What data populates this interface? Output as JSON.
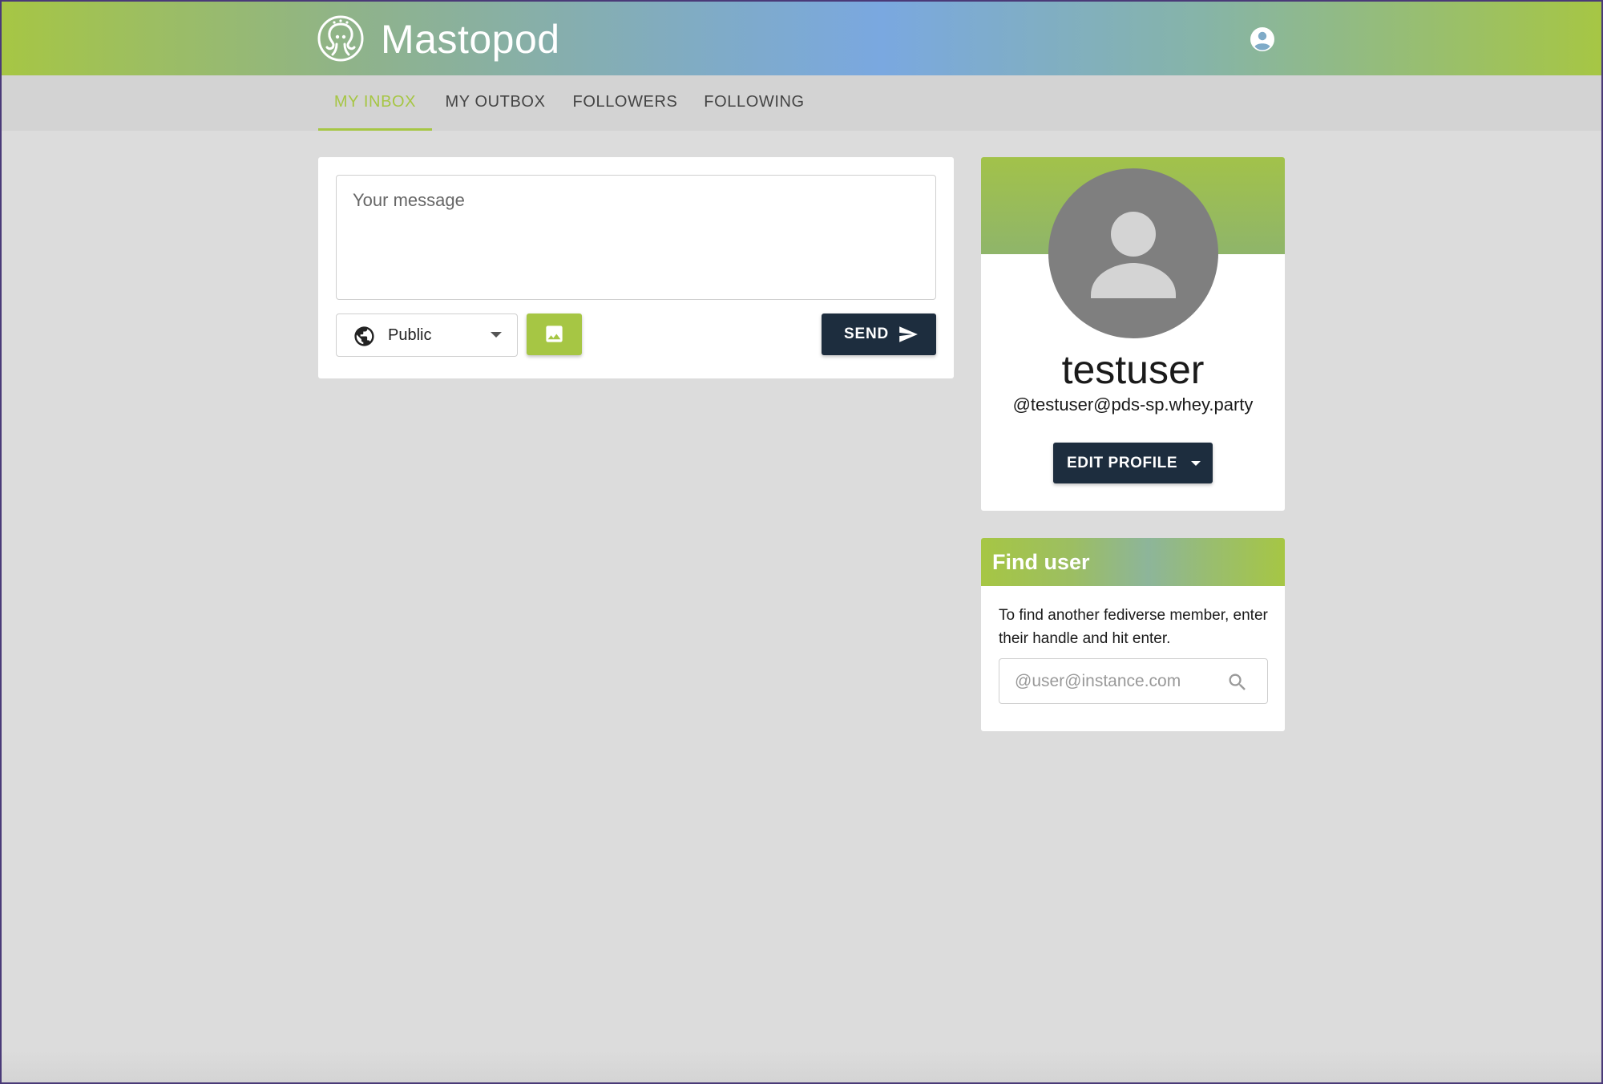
{
  "app": {
    "title": "Mastopod"
  },
  "header": {
    "account_icon": "account-circle-icon",
    "logo_icon": "octopod-logo-icon"
  },
  "tabs": [
    {
      "label": "MY INBOX",
      "active": true
    },
    {
      "label": "MY OUTBOX",
      "active": false
    },
    {
      "label": "FOLLOWERS",
      "active": false
    },
    {
      "label": "FOLLOWING",
      "active": false
    }
  ],
  "compose": {
    "message_placeholder": "Your message",
    "message_value": "",
    "visibility": {
      "selected": "Public",
      "icon": "globe-icon"
    },
    "image_button_icon": "image-icon",
    "send_label": "SEND",
    "send_icon": "send-icon"
  },
  "profile": {
    "username": "testuser",
    "handle": "@testuser@pds-sp.whey.party",
    "edit_label": "EDIT PROFILE",
    "avatar_icon": "person-icon"
  },
  "find_user": {
    "title": "Find user",
    "description": "To find another fediverse member, enter their handle and hit enter.",
    "input_placeholder": "@user@instance.com",
    "input_value": "",
    "search_icon": "search-icon"
  },
  "colors": {
    "accent": "#a6c644",
    "dark_button": "#1d2d3e",
    "background": "#dcdcdc",
    "tab_bar": "#d3d3d3"
  }
}
